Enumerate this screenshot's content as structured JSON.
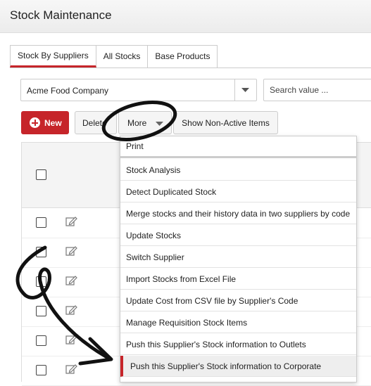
{
  "header": {
    "title": "Stock Maintenance"
  },
  "tabs": [
    {
      "label": "Stock By Suppliers",
      "active": true
    },
    {
      "label": "All Stocks",
      "active": false
    },
    {
      "label": "Base Products",
      "active": false
    }
  ],
  "filter": {
    "supplier_value": "Acme Food Company",
    "search_placeholder": "Search value ..."
  },
  "toolbar": {
    "new_label": "New",
    "delete_label": "Delete",
    "more_label": "More",
    "show_inactive_label": "Show Non-Active Items"
  },
  "menu": {
    "items": [
      {
        "label": "Print"
      },
      {
        "label": "Stock Analysis"
      },
      {
        "label": "Detect Duplicated Stock"
      },
      {
        "label": "Merge stocks and their history data in two suppliers by code"
      },
      {
        "label": "Update Stocks"
      },
      {
        "label": "Switch Supplier"
      },
      {
        "label": "Import Stocks from Excel File"
      },
      {
        "label": "Update Cost from CSV file by Supplier's Code"
      },
      {
        "label": "Manage Requisition Stock Items"
      },
      {
        "label": "Push this Supplier's Stock information to Outlets"
      },
      {
        "label": "Push this Supplier's Stock information to Corporate",
        "highlighted": true
      }
    ]
  },
  "colors": {
    "accent": "#c6252a",
    "header_bg": "#f0f0f0",
    "menu_hover": "#eeeeee"
  }
}
